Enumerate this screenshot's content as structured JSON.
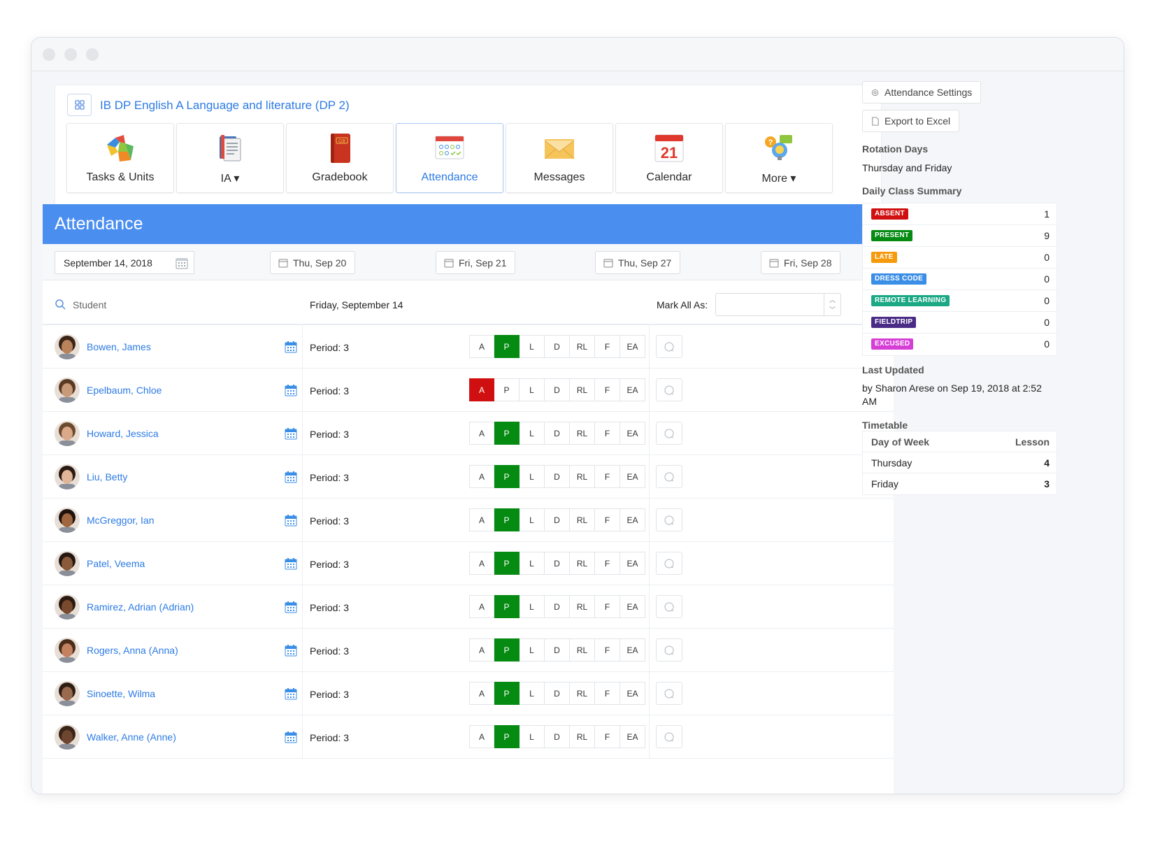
{
  "class": {
    "title": "IB DP English A Language and literature (DP 2)"
  },
  "tiles": [
    {
      "label": "Tasks & Units",
      "icon": "puzzle-icon"
    },
    {
      "label": "IA ▾",
      "icon": "documents-icon"
    },
    {
      "label": "Gradebook",
      "icon": "gradebook-icon"
    },
    {
      "label": "Attendance",
      "icon": "attendance-icon"
    },
    {
      "label": "Messages",
      "icon": "envelope-icon"
    },
    {
      "label": "Calendar",
      "icon": "calendar-icon",
      "calendar_day": "21"
    },
    {
      "label": "More ▾",
      "icon": "lightbulb-icon"
    }
  ],
  "banner": {
    "title": "Attendance"
  },
  "dates": {
    "current": "September 14, 2018",
    "chips": [
      "Thu, Sep 20",
      "Fri, Sep 21",
      "Thu, Sep 27",
      "Fri, Sep 28"
    ]
  },
  "table": {
    "student_placeholder": "Student",
    "date_heading": "Friday, September 14",
    "mark_all_label": "Mark All As:",
    "buttons": [
      "A",
      "P",
      "L",
      "D",
      "RL",
      "F",
      "EA"
    ],
    "rows": [
      {
        "name": "Bowen, James",
        "period": "Period: 3",
        "status": "P"
      },
      {
        "name": "Epelbaum, Chloe",
        "period": "Period: 3",
        "status": "A"
      },
      {
        "name": "Howard, Jessica",
        "period": "Period: 3",
        "status": "P"
      },
      {
        "name": "Liu, Betty",
        "period": "Period: 3",
        "status": "P"
      },
      {
        "name": "McGreggor, Ian",
        "period": "Period: 3",
        "status": "P"
      },
      {
        "name": "Patel, Veema",
        "period": "Period: 3",
        "status": "P"
      },
      {
        "name": "Ramirez, Adrian (Adrian)",
        "period": "Period: 3",
        "status": "P"
      },
      {
        "name": "Rogers, Anna (Anna)",
        "period": "Period: 3",
        "status": "P"
      },
      {
        "name": "Sinoette, Wilma",
        "period": "Period: 3",
        "status": "P"
      },
      {
        "name": "Walker, Anne (Anne)",
        "period": "Period: 3",
        "status": "P"
      }
    ]
  },
  "sidebar": {
    "settings_label": "Attendance Settings",
    "export_label": "Export to Excel",
    "rotation_heading": "Rotation Days",
    "rotation_value": "Thursday and Friday",
    "summary_heading": "Daily Class Summary",
    "summary": [
      {
        "label": "ABSENT",
        "count": "1",
        "color": "#d01010"
      },
      {
        "label": "PRESENT",
        "count": "9",
        "color": "#058a12"
      },
      {
        "label": "LATE",
        "count": "0",
        "color": "#f59a0c"
      },
      {
        "label": "DRESS CODE",
        "count": "0",
        "color": "#3a8ee6"
      },
      {
        "label": "REMOTE LEARNING",
        "count": "0",
        "color": "#1ba985"
      },
      {
        "label": "FIELDTRIP",
        "count": "0",
        "color": "#4a2b86"
      },
      {
        "label": "EXCUSED",
        "count": "0",
        "color": "#d63fd6"
      }
    ],
    "last_updated_heading": "Last Updated",
    "last_updated_value": "by Sharon Arese on Sep 19, 2018 at 2:52 AM",
    "timetable_heading": "Timetable",
    "timetable_col_day": "Day of Week",
    "timetable_col_lesson": "Lesson",
    "timetable": [
      {
        "day": "Thursday",
        "lesson": "4"
      },
      {
        "day": "Friday",
        "lesson": "3"
      }
    ]
  }
}
